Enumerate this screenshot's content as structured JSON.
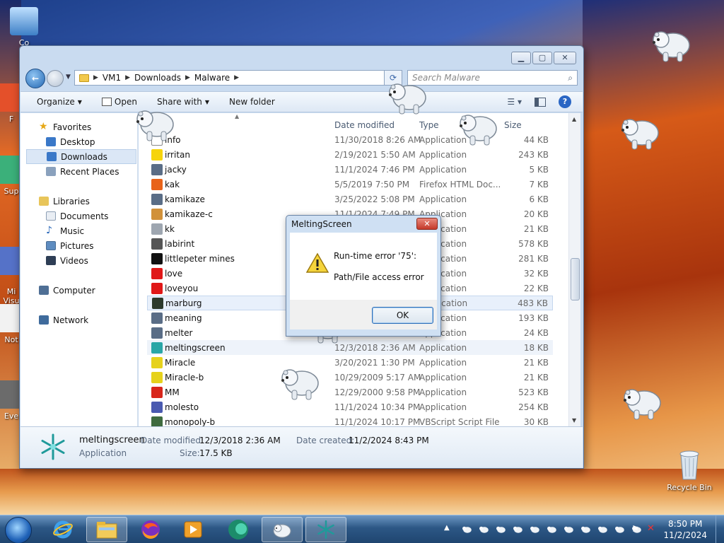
{
  "desktop": {
    "icons": [
      {
        "label": "Co"
      },
      {
        "label": "F"
      },
      {
        "label": "Sup"
      },
      {
        "label": "Mi\nVisu"
      },
      {
        "label": "Not"
      },
      {
        "label": "Eve"
      },
      {
        "label": "Recycle Bin"
      }
    ]
  },
  "explorer": {
    "breadcrumb": [
      "VM1",
      "Downloads",
      "Malware"
    ],
    "search_placeholder": "Search Malware",
    "toolbar": {
      "organize": "Organize",
      "open": "Open",
      "share_with": "Share with",
      "new_folder": "New folder"
    },
    "nav": {
      "favorites": "Favorites",
      "desktop": "Desktop",
      "downloads": "Downloads",
      "recent_places": "Recent Places",
      "libraries": "Libraries",
      "documents": "Documents",
      "music": "Music",
      "pictures": "Pictures",
      "videos": "Videos",
      "computer": "Computer",
      "network": "Network"
    },
    "columns": {
      "date": "Date modified",
      "type": "Type",
      "size": "Size"
    },
    "files": [
      {
        "name": "info",
        "date": "11/30/2018 8:26 AM",
        "type": "Application",
        "size": "44 KB",
        "icon": "generic-app-icon",
        "color": "#ffffff"
      },
      {
        "name": "irritan",
        "date": "2/19/2021 5:50 AM",
        "type": "Application",
        "size": "243 KB",
        "icon": "smiley-icon",
        "color": "#f6d40b"
      },
      {
        "name": "jacky",
        "date": "11/1/2024 7:46 PM",
        "type": "Application",
        "size": "5 KB",
        "icon": "window-app-icon",
        "color": "#5a6d86"
      },
      {
        "name": "kak",
        "date": "5/5/2019 7:50 PM",
        "type": "Firefox HTML Doc...",
        "size": "7 KB",
        "icon": "firefox-doc-icon",
        "color": "#e8631a"
      },
      {
        "name": "kamikaze",
        "date": "3/25/2022 5:08 PM",
        "type": "Application",
        "size": "6 KB",
        "icon": "window-app-icon",
        "color": "#5a6d86"
      },
      {
        "name": "kamikaze-c",
        "date": "11/1/2024 7:49 PM",
        "type": "Application",
        "size": "20 KB",
        "icon": "palette-icon",
        "color": "#d1913a"
      },
      {
        "name": "kk",
        "date": "",
        "type": "Application",
        "size": "21 KB",
        "icon": "mouse-icon",
        "color": "#9ea6b0"
      },
      {
        "name": "labirint",
        "date": "",
        "type": "Application",
        "size": "578 KB",
        "icon": "skull-icon",
        "color": "#555555"
      },
      {
        "name": "littlepeter mines",
        "date": "",
        "type": "Application",
        "size": "281 KB",
        "icon": "mine-icon",
        "color": "#111111"
      },
      {
        "name": "love",
        "date": "",
        "type": "Application",
        "size": "32 KB",
        "icon": "heart-icon",
        "color": "#e01818"
      },
      {
        "name": "loveyou",
        "date": "",
        "type": "Application",
        "size": "22 KB",
        "icon": "heart-icon",
        "color": "#e01818"
      },
      {
        "name": "marburg",
        "date": "",
        "type": "Application",
        "size": "483 KB",
        "icon": "monitor-icon",
        "color": "#2c3a2c"
      },
      {
        "name": "meaning",
        "date": "",
        "type": "Application",
        "size": "193 KB",
        "icon": "window-app-icon",
        "color": "#5a6d86"
      },
      {
        "name": "melter",
        "date": "",
        "type": "Application",
        "size": "24 KB",
        "icon": "window-app-icon",
        "color": "#5a6d86"
      },
      {
        "name": "meltingscreen",
        "date": "12/3/2018 2:36 AM",
        "type": "Application",
        "size": "18 KB",
        "icon": "snowflake-icon",
        "color": "#2aa6a6"
      },
      {
        "name": "Miracle",
        "date": "3/20/2021 1:30 PM",
        "type": "Application",
        "size": "21 KB",
        "icon": "pencil-icon",
        "color": "#e6d21c"
      },
      {
        "name": "Miracle-b",
        "date": "10/29/2009 5:17 AM",
        "type": "Application",
        "size": "21 KB",
        "icon": "pencil-icon",
        "color": "#e6d21c"
      },
      {
        "name": "MM",
        "date": "12/29/2000 9:58 PM",
        "type": "Application",
        "size": "523 KB",
        "icon": "mcdonalds-icon",
        "color": "#d8261b"
      },
      {
        "name": "molesto",
        "date": "11/1/2024 10:34 PM",
        "type": "Application",
        "size": "254 KB",
        "icon": "books-icon",
        "color": "#4a5ab0"
      },
      {
        "name": "monopoly-b",
        "date": "11/1/2024 10:17 PM",
        "type": "VBScript Script File",
        "size": "30 KB",
        "icon": "script-icon",
        "color": "#3f6b3f"
      }
    ],
    "details": {
      "name": "meltingscreen",
      "kind": "Application",
      "date_modified_label": "Date modified:",
      "date_modified": "12/3/2018 2:36 AM",
      "date_created_label": "Date created:",
      "date_created": "11/2/2024 8:43 PM",
      "size_label": "Size:",
      "size": "17.5 KB"
    }
  },
  "dialog": {
    "title": "MeltingScreen",
    "line1": "Run-time error '75':",
    "line2": "Path/File access error",
    "ok": "OK"
  },
  "taskbar": {
    "time": "8:50 PM",
    "date": "11/2/2024"
  },
  "colors": {
    "selection": "#dbe7f6",
    "dialog_frame": "#cfe0f3",
    "taskbar": "#2c5785"
  }
}
